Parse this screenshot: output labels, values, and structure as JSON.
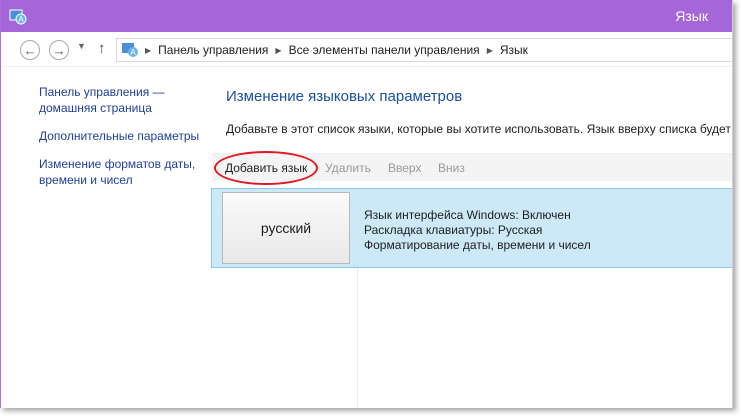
{
  "window": {
    "title": "Язык",
    "accent_color": "#a566d9",
    "title_icon": "control-panel-icon"
  },
  "addressbar": {
    "back_icon": "back-arrow-icon",
    "forward_icon": "forward-arrow-icon",
    "recent_icon": "chevron-down-icon",
    "up_icon": "up-arrow-icon",
    "location_icon": "control-panel-icon",
    "breadcrumbs": [
      "Панель управления",
      "Все элементы панели управления",
      "Язык"
    ]
  },
  "sidebar": {
    "links": [
      "Панель управления — домашняя страница",
      "Дополнительные параметры",
      "Изменение форматов даты, времени и чисел"
    ]
  },
  "main": {
    "title": "Изменение языковых параметров",
    "description": "Добавьте в этот список языки, которые вы хотите использовать. Язык вверху списка будет о"
  },
  "toolbar": {
    "add_language": "Добавить язык",
    "remove": "Удалить",
    "move_up": "Вверх",
    "move_down": "Вниз"
  },
  "languages": [
    {
      "name": "русский",
      "details": [
        "Язык интерфейса Windows: Включен",
        "Раскладка клавиатуры: Русская",
        "Форматирование даты, времени и чисел"
      ]
    }
  ]
}
